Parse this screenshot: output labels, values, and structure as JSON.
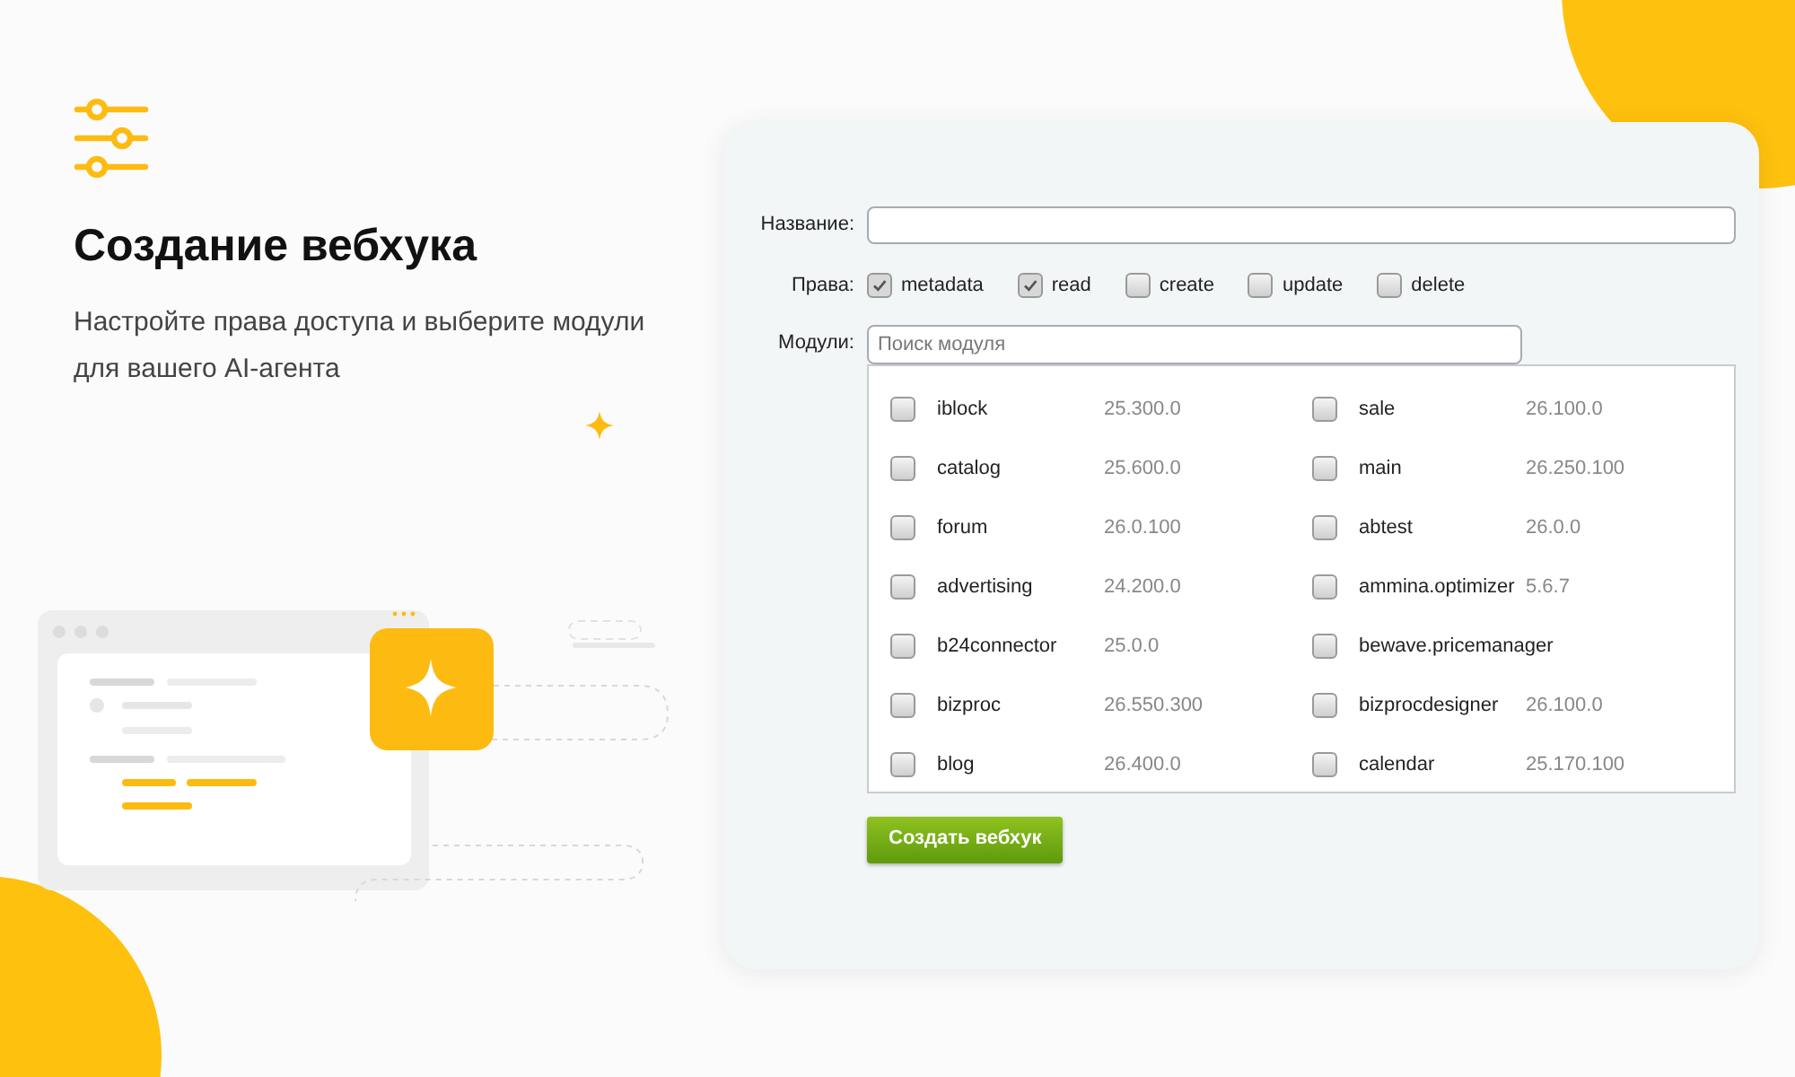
{
  "header": {
    "title": "Создание вебхука",
    "subtitle": "Настройте права доступа и выберите модули для вашего AI-агента"
  },
  "form": {
    "name_label": "Название:",
    "rights_label": "Права:",
    "rights": [
      {
        "label": "metadata",
        "checked": true
      },
      {
        "label": "read",
        "checked": true
      },
      {
        "label": "create",
        "checked": false
      },
      {
        "label": "update",
        "checked": false
      },
      {
        "label": "delete",
        "checked": false
      }
    ],
    "modules_label": "Модули:",
    "modules_search": {
      "placeholder": "Поиск модуля"
    },
    "modules": [
      {
        "name": "iblock",
        "version": "25.300.0",
        "checked": false
      },
      {
        "name": "sale",
        "version": "26.100.0",
        "checked": false
      },
      {
        "name": "catalog",
        "version": "25.600.0",
        "checked": false
      },
      {
        "name": "main",
        "version": "26.250.100",
        "checked": false
      },
      {
        "name": "forum",
        "version": "26.0.100",
        "checked": false
      },
      {
        "name": "abtest",
        "version": "26.0.0",
        "checked": false
      },
      {
        "name": "advertising",
        "version": "24.200.0",
        "checked": false
      },
      {
        "name": "ammina.optimizer",
        "version": "5.6.7",
        "checked": false
      },
      {
        "name": "b24connector",
        "version": "25.0.0",
        "checked": false
      },
      {
        "name": "bewave.pricemanager",
        "checked": false
      },
      {
        "name": "bizproc",
        "version": "26.550.300",
        "checked": false
      },
      {
        "name": "bizprocdesigner",
        "version": "26.100.0",
        "checked": false
      },
      {
        "name": "blog",
        "version": "26.400.0",
        "checked": false
      },
      {
        "name": "calendar",
        "version": "25.170.100",
        "checked": false
      }
    ],
    "submit": "Создать вебхук"
  }
}
